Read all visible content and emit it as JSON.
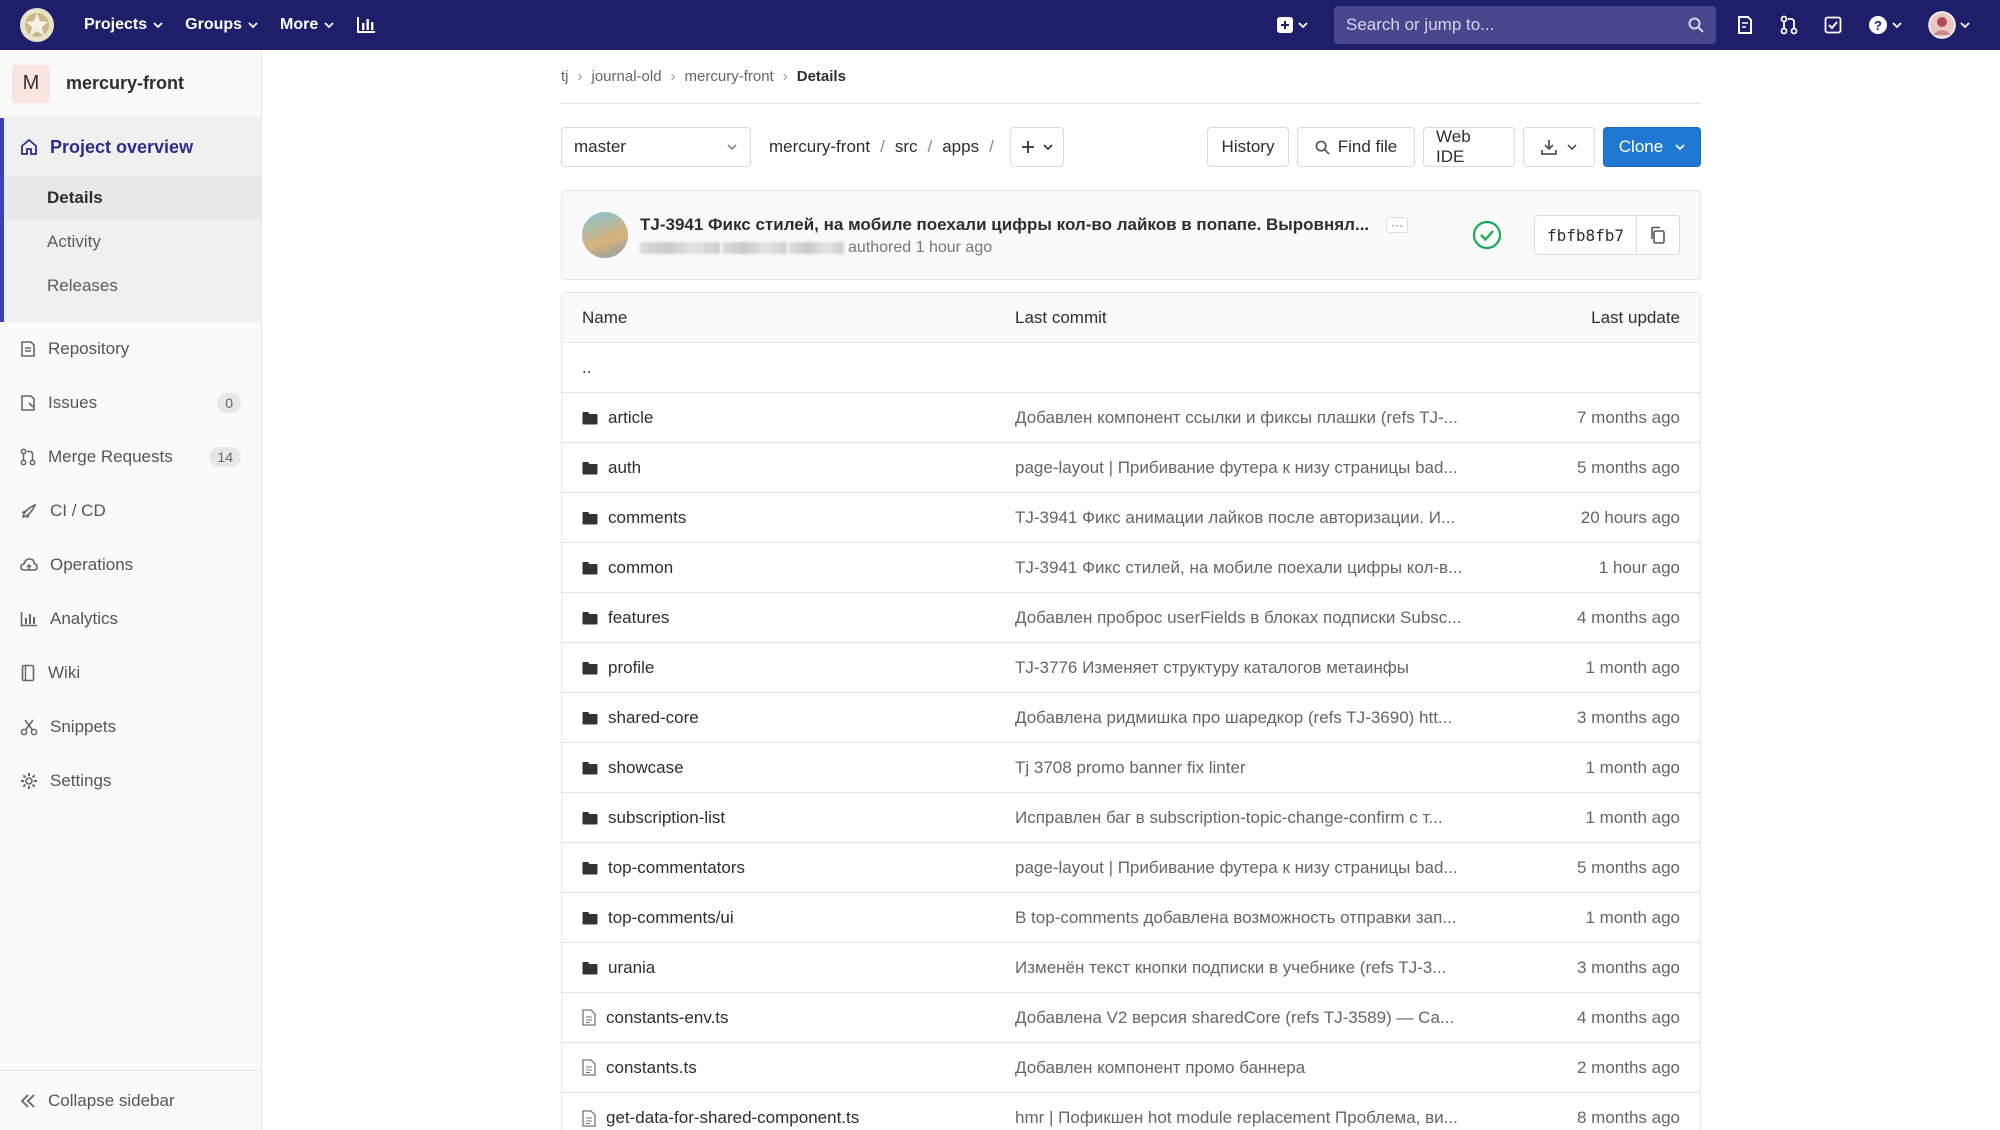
{
  "topbar": {
    "nav": [
      {
        "label": "Projects"
      },
      {
        "label": "Groups"
      },
      {
        "label": "More"
      }
    ],
    "search_placeholder": "Search or jump to..."
  },
  "sidebar": {
    "project_initial": "M",
    "project_name": "mercury-front",
    "overview_label": "Project overview",
    "overview_sub": [
      {
        "label": "Details"
      },
      {
        "label": "Activity"
      },
      {
        "label": "Releases"
      }
    ],
    "items": [
      {
        "label": "Repository",
        "icon": "repository-icon"
      },
      {
        "label": "Issues",
        "icon": "issues-icon",
        "count": "0"
      },
      {
        "label": "Merge Requests",
        "icon": "merge-request-icon",
        "count": "14"
      },
      {
        "label": "CI / CD",
        "icon": "rocket-icon"
      },
      {
        "label": "Operations",
        "icon": "cloud-icon"
      },
      {
        "label": "Analytics",
        "icon": "chart-icon"
      },
      {
        "label": "Wiki",
        "icon": "book-icon"
      },
      {
        "label": "Snippets",
        "icon": "scissors-icon"
      },
      {
        "label": "Settings",
        "icon": "gear-icon"
      }
    ],
    "collapse_label": "Collapse sidebar"
  },
  "breadcrumb": {
    "items": [
      "tj",
      "journal-old",
      "mercury-front"
    ],
    "current": "Details"
  },
  "toolbar": {
    "branch": "master",
    "path": [
      "mercury-front",
      "src",
      "apps"
    ],
    "history_label": "History",
    "find_file_label": "Find file",
    "web_ide_label": "Web IDE",
    "clone_label": "Clone"
  },
  "commit": {
    "title": "TJ-3941 Фикс стилей, на мобиле поехали цифры кол-во лайков в попапе. Выровнял...",
    "ellipsis": "···",
    "meta": "authored 1 hour ago",
    "sha": "fbfb8fb7",
    "accent": "#1aaa55"
  },
  "table": {
    "headers": {
      "name": "Name",
      "last_commit": "Last commit",
      "last_update": "Last update"
    },
    "parent": "..",
    "rows": [
      {
        "type": "folder",
        "name": "article",
        "commit": "Добавлен компонент ссылки и фиксы плашки (refs TJ-...",
        "update": "7 months ago"
      },
      {
        "type": "folder",
        "name": "auth",
        "commit": "page-layout | Прибивание футера к низу страницы bad...",
        "update": "5 months ago"
      },
      {
        "type": "folder",
        "name": "comments",
        "commit": "TJ-3941 Фикс анимации лайков после авторизации. И...",
        "update": "20 hours ago"
      },
      {
        "type": "folder",
        "name": "common",
        "commit": "TJ-3941 Фикс стилей, на мобиле поехали цифры кол-в...",
        "update": "1 hour ago"
      },
      {
        "type": "folder",
        "name": "features",
        "commit": "Добавлен проброс userFields в блоках подписки Subsc...",
        "update": "4 months ago"
      },
      {
        "type": "folder",
        "name": "profile",
        "commit": "TJ-3776 Изменяет структуру каталогов метаинфы",
        "update": "1 month ago"
      },
      {
        "type": "folder",
        "name": "shared-core",
        "commit": "Добавлена ридмишка про шаредкор (refs TJ-3690) htt...",
        "update": "3 months ago"
      },
      {
        "type": "folder",
        "name": "showcase",
        "commit": "Tj 3708 promo banner fix linter",
        "update": "1 month ago"
      },
      {
        "type": "folder",
        "name": "subscription-list",
        "commit": "Исправлен баг в subscription-topic-change-confirm с т...",
        "update": "1 month ago"
      },
      {
        "type": "folder",
        "name": "top-commentators",
        "commit": "page-layout | Прибивание футера к низу страницы bad...",
        "update": "5 months ago"
      },
      {
        "type": "folder",
        "name": "top-comments/ui",
        "commit": "В top-comments добавлена возможность отправки зап...",
        "update": "1 month ago"
      },
      {
        "type": "folder",
        "name": "urania",
        "commit": "Изменён текст кнопки подписки в учебнике (refs TJ-3...",
        "update": "3 months ago"
      },
      {
        "type": "file",
        "name": "constants-env.ts",
        "commit": "Добавлена V2 версия sharedCore (refs TJ-3589) — Ca...",
        "update": "4 months ago"
      },
      {
        "type": "file",
        "name": "constants.ts",
        "commit": "Добавлен компонент промо баннера",
        "update": "2 months ago"
      },
      {
        "type": "file",
        "name": "get-data-for-shared-component.ts",
        "commit": "hmr | Пофикшен hot module replacement Проблема, ви...",
        "update": "8 months ago"
      }
    ]
  }
}
